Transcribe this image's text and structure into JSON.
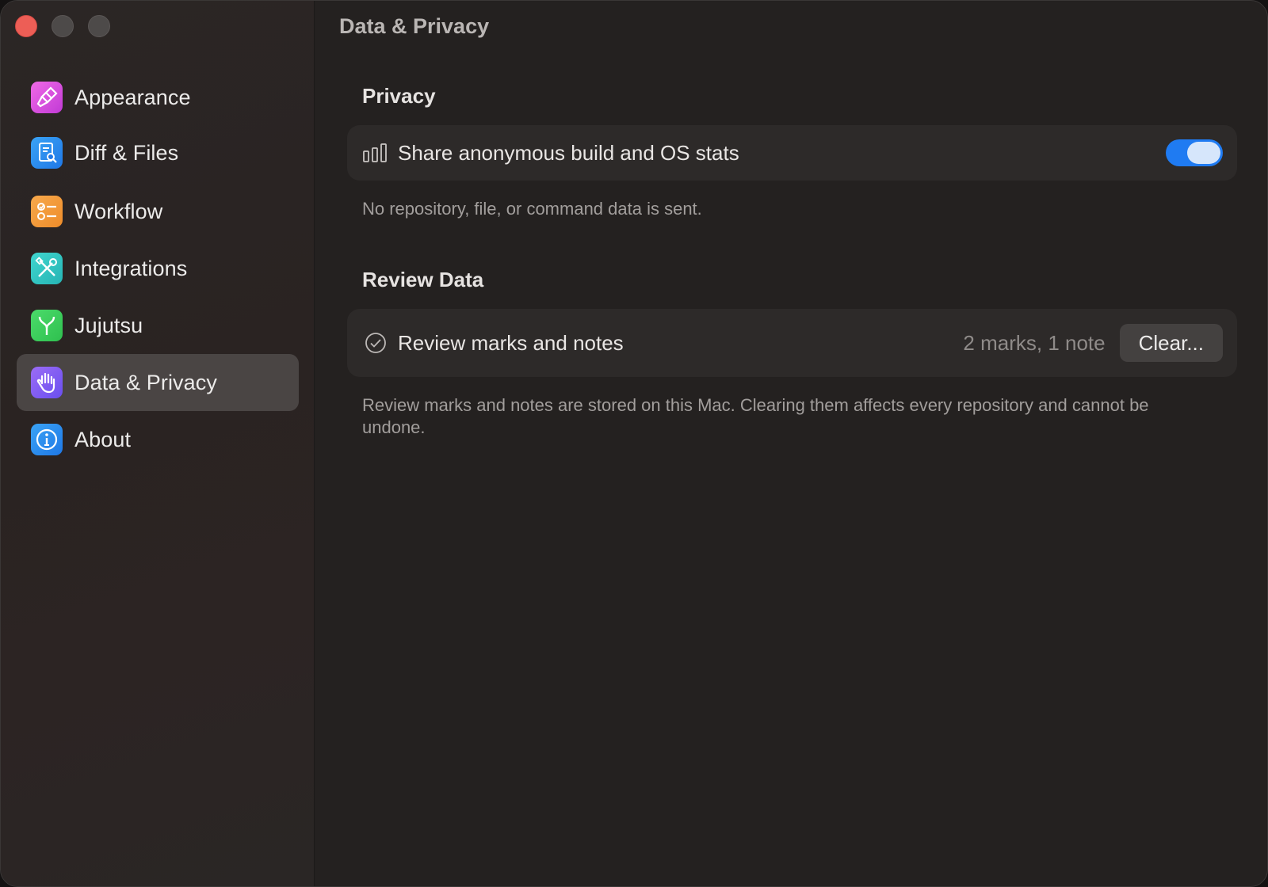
{
  "window": {
    "title": "Data & Privacy"
  },
  "sidebar": {
    "items": [
      {
        "label": "Appearance",
        "icon": "paintbrush-icon",
        "color": "#e84fd8",
        "active": false
      },
      {
        "label": "Diff & Files",
        "icon": "doc-magnifier-icon",
        "color": "#2a8ff0",
        "active": false
      },
      {
        "label": "Workflow",
        "icon": "checklist-icon",
        "color": "#f39a3a",
        "active": false
      },
      {
        "label": "Integrations",
        "icon": "tools-icon",
        "color": "#33c9c4",
        "active": false
      },
      {
        "label": "Jujutsu",
        "icon": "branch-icon",
        "color": "#3ccf5a",
        "active": false
      },
      {
        "label": "Data & Privacy",
        "icon": "hand-icon",
        "color": "#7d5cf0",
        "active": true
      },
      {
        "label": "About",
        "icon": "info-icon",
        "color": "#2a8ff0",
        "active": false
      }
    ]
  },
  "privacy": {
    "heading": "Privacy",
    "stats_label": "Share anonymous build and OS stats",
    "stats_enabled": true,
    "note": "No repository, file, or command data is sent."
  },
  "review": {
    "heading": "Review Data",
    "label": "Review marks and notes",
    "count": "2 marks, 1 note",
    "clear_label": "Clear...",
    "note": "Review marks and notes are stored on this Mac. Clearing them affects every repository and cannot be undone."
  },
  "colors": {
    "accent": "#1f7bf2",
    "close": "#ed5e56"
  }
}
